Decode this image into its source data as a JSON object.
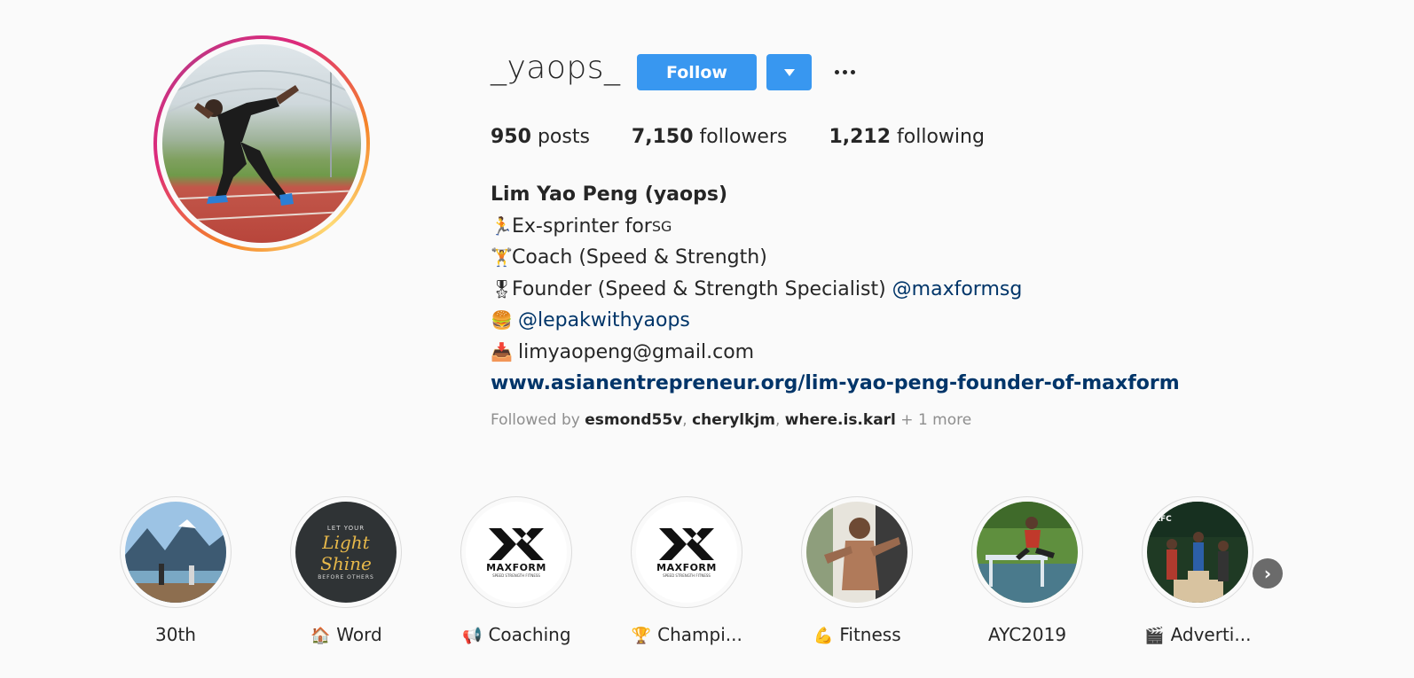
{
  "profile": {
    "username": "_yaops_",
    "follow_label": "Follow",
    "stats": [
      {
        "count": "950",
        "label": "posts"
      },
      {
        "count": "7,150",
        "label": "followers"
      },
      {
        "count": "1,212",
        "label": "following"
      }
    ],
    "full_name": "Lim Yao Peng (yaops)",
    "bio_lines": [
      {
        "emoji": "🏃",
        "text": "Ex-sprinter for ",
        "suffix": "SG"
      },
      {
        "emoji": "🏋",
        "text": "Coach (Speed & Strength)"
      },
      {
        "emoji": "🎖",
        "text": "Founder (Speed & Strength Specialist) ",
        "mention": "@maxformsg"
      },
      {
        "emoji": "🍔",
        "mention": "@lepakwithyaops"
      },
      {
        "emoji": "📥",
        "text": "limyaopeng@gmail.com"
      }
    ],
    "website": "www.asianentrepreneur.org/lim-yao-peng-founder-of-maxform",
    "followed_by": {
      "prefix": "Followed by ",
      "names": [
        "esmond55v",
        "cherylkjm",
        "where.is.karl"
      ],
      "more": "+ 1 more"
    }
  },
  "highlights": [
    {
      "emoji": "",
      "label": "30th"
    },
    {
      "emoji": "🏠",
      "label": "Word"
    },
    {
      "emoji": "📢",
      "label": "Coaching"
    },
    {
      "emoji": "🏆",
      "label": "Champi..."
    },
    {
      "emoji": "💪",
      "label": "Fitness"
    },
    {
      "emoji": "",
      "label": "AYC2019"
    },
    {
      "emoji": "🎬",
      "label": "Adverti..."
    }
  ],
  "highlight_art": {
    "word_top": "LET YOUR",
    "word_main": "Light Shine",
    "word_bottom": "BEFORE OTHERS",
    "maxform_brand": "MAXFORM",
    "maxform_tag": "SPEED STRENGTH FITNESS",
    "kfc_logo": "KFC"
  },
  "colors": {
    "accent": "#3897f0",
    "link": "#003569",
    "muted": "#8e8e8e"
  },
  "icons": {
    "more": "more-horizontal-icon",
    "dropdown": "caret-down-icon",
    "next": "chevron-right-icon"
  }
}
